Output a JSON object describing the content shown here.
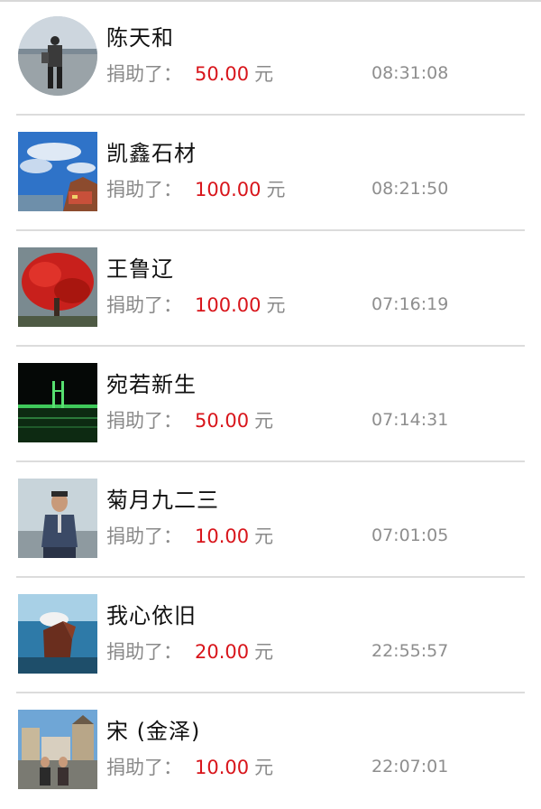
{
  "donations": [
    {
      "name": "陈天和",
      "prefix": "捐助了：",
      "amount": "50.00",
      "unit": "元",
      "time": "08:31:08",
      "avatar_icon": "person-seaside-avatar"
    },
    {
      "name": "凯鑫石材",
      "prefix": "捐助了：",
      "amount": "100.00",
      "unit": "元",
      "time": "08:21:50",
      "avatar_icon": "sky-coast-avatar"
    },
    {
      "name": "王鲁辽",
      "prefix": "捐助了：",
      "amount": "100.00",
      "unit": "元",
      "time": "07:16:19",
      "avatar_icon": "red-tree-avatar"
    },
    {
      "name": "宛若新生",
      "prefix": "捐助了：",
      "amount": "50.00",
      "unit": "元",
      "time": "07:14:31",
      "avatar_icon": "night-bridge-avatar"
    },
    {
      "name": "菊月九二三",
      "prefix": "捐助了：",
      "amount": "10.00",
      "unit": "元",
      "time": "07:01:05",
      "avatar_icon": "man-portrait-avatar"
    },
    {
      "name": "我心依旧",
      "prefix": "捐助了：",
      "amount": "20.00",
      "unit": "元",
      "time": "22:55:57",
      "avatar_icon": "horse-avatar"
    },
    {
      "name": "宋 (金泽)",
      "prefix": "捐助了：",
      "amount": "10.00",
      "unit": "元",
      "time": "22:07:01",
      "avatar_icon": "group-building-avatar"
    }
  ],
  "colors": {
    "amount": "#d8151b",
    "muted_text": "#8a8a8a",
    "divider": "#dcdcdc"
  }
}
